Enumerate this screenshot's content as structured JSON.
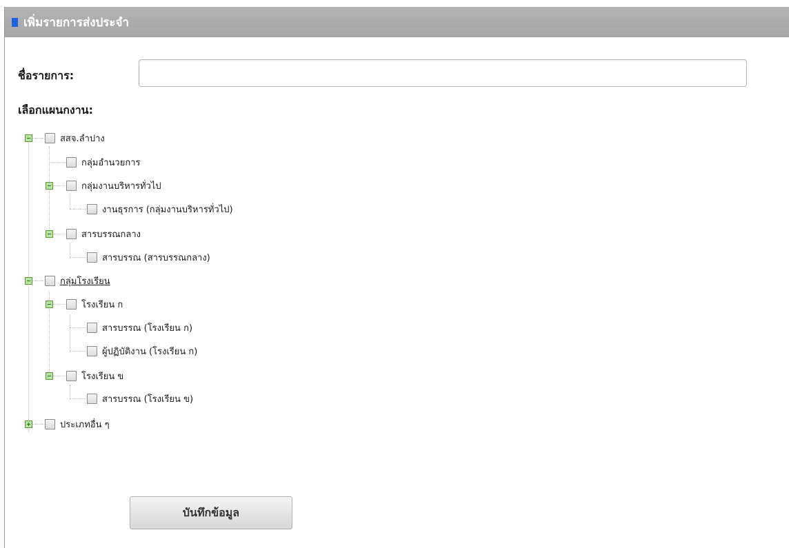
{
  "header": {
    "title": "เพิ่มรายการส่งประจำ",
    "accent": "#1b63e0"
  },
  "form": {
    "name_label": "ชื่อรายการ:",
    "name_value": "",
    "name_placeholder": "",
    "plan_label": "เลือกแผนกงาน:"
  },
  "tree": {
    "n1": "สสจ.ลำปาง",
    "n1a": "กลุ่มอำนวยการ",
    "n1b": "กลุ่มงานบริหารทั่วไป",
    "n1b1": "งานธุรการ (กลุ่มงานบริหารทั่วไป)",
    "n1c": "สารบรรณกลาง",
    "n1c1": "สารบรรณ (สารบรรณกลาง)",
    "n2": "กลุ่มโรงเรียน",
    "n2a": "โรงเรียน ก",
    "n2a1": "สารบรรณ (โรงเรียน ก)",
    "n2a2": "ผู้ปฏิบัติงาน (โรงเรียน ก)",
    "n2b": "โรงเรียน ข",
    "n2b1": "สารบรรณ (โรงเรียน ข)",
    "n3": "ประเภทอื่น ๆ"
  },
  "actions": {
    "save_label": "บันทึกข้อมูล"
  }
}
